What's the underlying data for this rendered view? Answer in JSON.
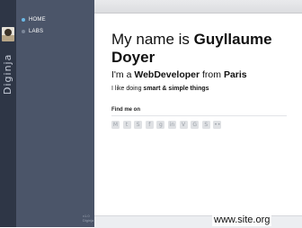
{
  "sidebar": {
    "brand": "Diginja",
    "nav": [
      {
        "label": "HOME",
        "active": true
      },
      {
        "label": "LABS",
        "active": false
      }
    ],
    "footer_line1": "v1.0",
    "footer_line2": "Diginja"
  },
  "intro": {
    "title_prefix": "My name is ",
    "name": "Guyllaume Doyer",
    "subtitle_prefix": "I'm a ",
    "role": "WebDeveloper",
    "subtitle_middle": " from ",
    "city": "Paris",
    "tagline_prefix": "I like doing ",
    "tagline_strong": "smart & simple things"
  },
  "social": {
    "heading": "Find me on",
    "icons": [
      {
        "name": "gmail-icon",
        "glyph": "M"
      },
      {
        "name": "twitter-icon",
        "glyph": "t"
      },
      {
        "name": "skype-icon",
        "glyph": "S"
      },
      {
        "name": "facebook-icon",
        "glyph": "f"
      },
      {
        "name": "google-plus-icon",
        "glyph": "g"
      },
      {
        "name": "linkedin-icon",
        "glyph": "in"
      },
      {
        "name": "viadeo-icon",
        "glyph": "V"
      },
      {
        "name": "github-icon",
        "glyph": "G"
      },
      {
        "name": "stackoverflow-icon",
        "glyph": "S"
      },
      {
        "name": "flickr-icon",
        "glyph": "••"
      }
    ]
  },
  "watermark": "www.site.org",
  "colors": {
    "sidebar": "#4b5569",
    "rail": "#2e3646",
    "active_dot": "#6bb8e6"
  }
}
